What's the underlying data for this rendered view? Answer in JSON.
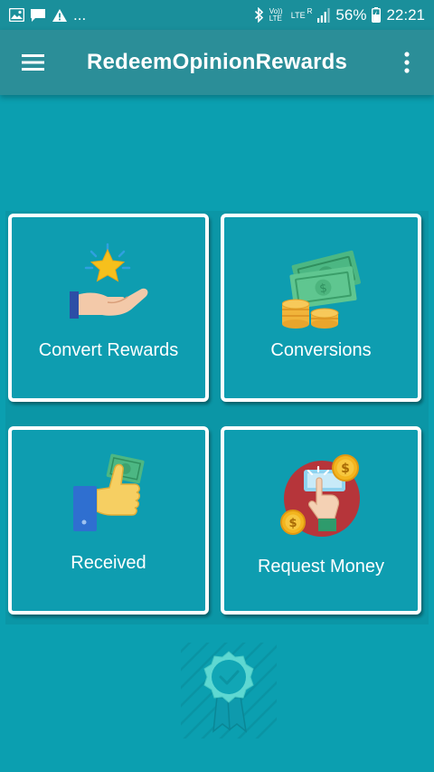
{
  "status_bar": {
    "battery": "56%",
    "time": "22:21",
    "network_volte": "Vo)) LTE",
    "network_lte": "LTE",
    "network_r": "R",
    "ellipsis": "...",
    "icons": [
      "image-icon",
      "message-icon",
      "warning-icon",
      "bluetooth-icon",
      "signal-icon",
      "battery-icon"
    ]
  },
  "app_bar": {
    "title": "RedeemOpinionRewards",
    "menu_icon": "hamburger-menu-icon",
    "more_icon": "more-vert-icon"
  },
  "tiles": [
    {
      "label": "Convert Rewards",
      "icon": "hand-star-icon"
    },
    {
      "label": "Conversions",
      "icon": "cash-coins-icon"
    },
    {
      "label": "Received",
      "icon": "thumbs-up-cash-icon"
    },
    {
      "label": "Request Money",
      "icon": "tap-payment-icon"
    }
  ],
  "footer": {
    "icon": "award-badge-icon"
  },
  "colors": {
    "background": "#0b9fb0",
    "app_bar": "#2b8e98",
    "tile_border": "#ffffff"
  }
}
